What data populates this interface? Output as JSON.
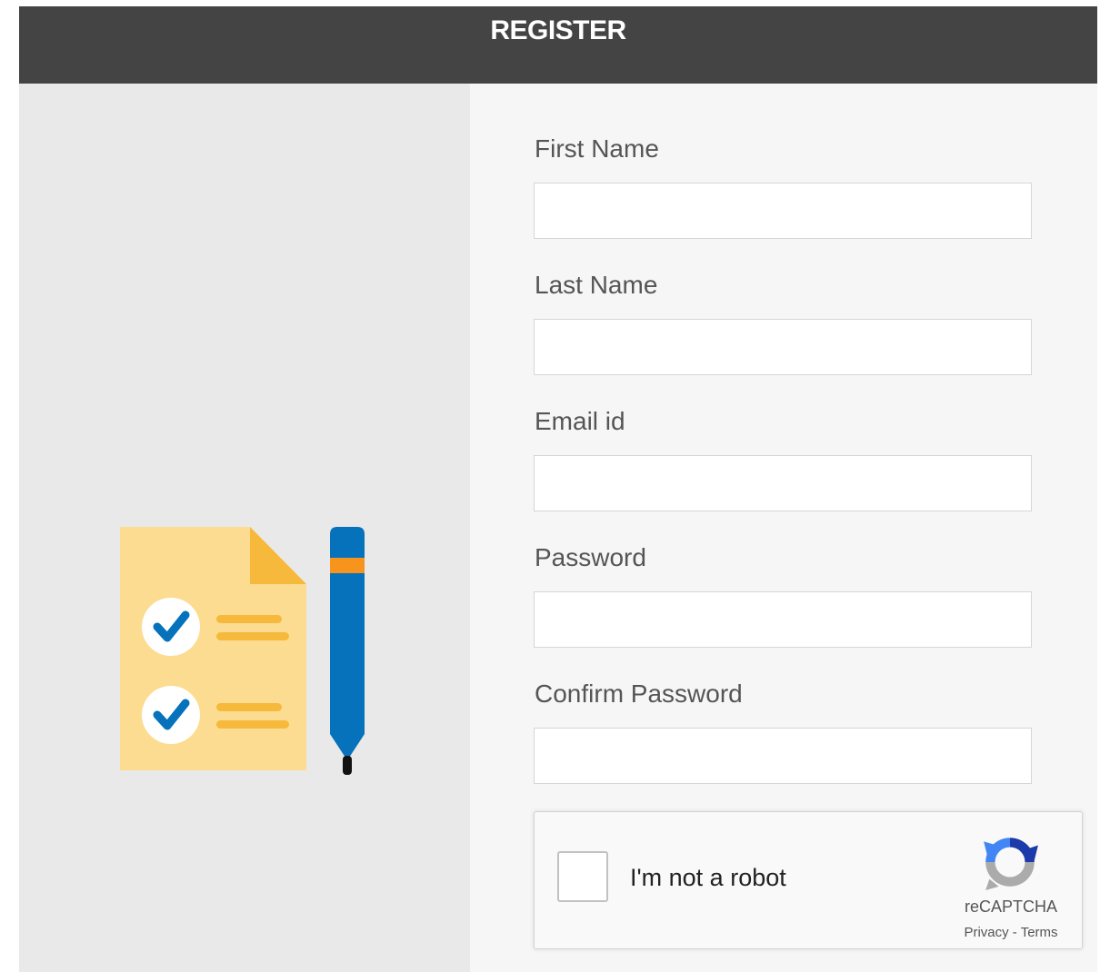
{
  "header": {
    "title": "REGISTER"
  },
  "form": {
    "fields": [
      {
        "label": "First Name",
        "value": ""
      },
      {
        "label": "Last Name",
        "value": ""
      },
      {
        "label": "Email id",
        "value": ""
      },
      {
        "label": "Password",
        "value": ""
      },
      {
        "label": "Confirm Password",
        "value": ""
      }
    ]
  },
  "captcha": {
    "label": "I'm not a robot",
    "brand": "reCAPTCHA",
    "privacy": "Privacy",
    "separator": " - ",
    "terms": "Terms"
  },
  "colors": {
    "header_bg": "#444444",
    "left_panel_bg": "#e9e9e9",
    "right_panel_bg": "#f6f6f6",
    "doc_yellow": "#fcdc91",
    "doc_fold": "#f6b93b",
    "pen_blue": "#0572bb",
    "pen_band": "#f7941e"
  },
  "icons": [
    "document-checklist-icon",
    "check-icon",
    "pen-icon",
    "recaptcha-logo-icon"
  ]
}
